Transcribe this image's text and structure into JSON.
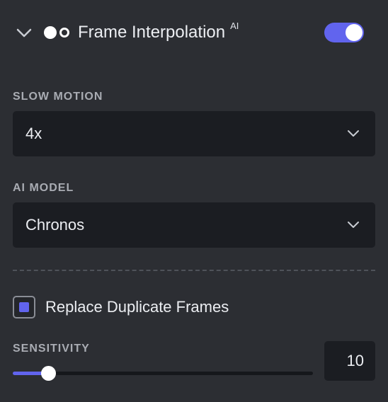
{
  "header": {
    "title": "Frame Interpolation",
    "badge": "AI",
    "enabled": true,
    "collapse_icon": "chevron-down-icon",
    "feature_icon": "frame-interpolation-icon"
  },
  "slow_motion": {
    "label": "SLOW MOTION",
    "value": "4x"
  },
  "ai_model": {
    "label": "AI MODEL",
    "value": "Chronos"
  },
  "replace_duplicates": {
    "label": "Replace Duplicate Frames",
    "checked": true
  },
  "sensitivity": {
    "label": "SENSITIVITY",
    "value": "10",
    "min": 0,
    "max": 100
  },
  "colors": {
    "accent": "#6164ee",
    "panel_bg": "#2c2e33",
    "field_bg": "#1b1d22",
    "label_text": "#a9acb3",
    "primary_text": "#eceef2"
  }
}
